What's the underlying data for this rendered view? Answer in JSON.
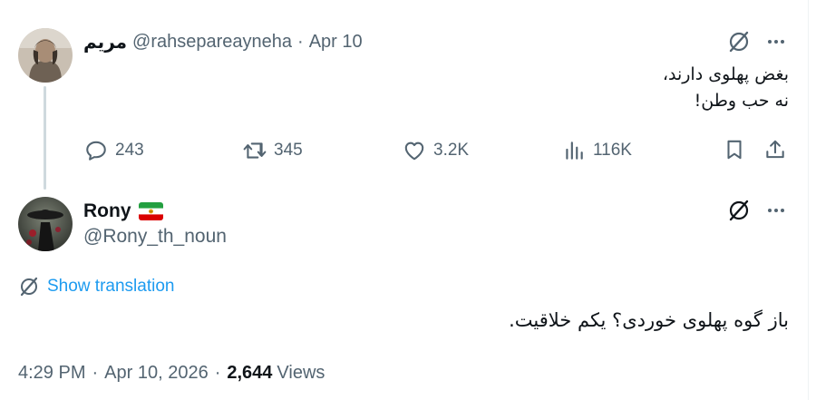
{
  "tweet1": {
    "display_name": "مریم",
    "handle": "@rahsepareayneha",
    "separator": "·",
    "date": "Apr 10",
    "text_line1": "بغض پهلوی دارند،",
    "text_line2": "نه حب وطن!",
    "actions": {
      "replies": "243",
      "reposts": "345",
      "likes": "3.2K",
      "views": "116K"
    },
    "icons": [
      "grok-icon",
      "more-icon",
      "reply-icon",
      "repost-icon",
      "like-icon",
      "views-icon",
      "bookmark-icon",
      "share-icon"
    ]
  },
  "tweet2": {
    "display_name": "Rony",
    "flag_icon": "iran-lion-and-sun-flag",
    "handle": "@Rony_th_noun",
    "translate_label": "Show translation",
    "text": "باز گوه پهلوی خوردی؟ یکم خلاقیت.",
    "time": "4:29 PM",
    "separator": "·",
    "date": "Apr 10, 2026",
    "views_count": "2,644",
    "views_label": "Views"
  },
  "colors": {
    "text_primary": "#0f1419",
    "text_secondary": "#536471",
    "link_blue": "#1d9bf0",
    "thread_line": "#cfd9de"
  }
}
